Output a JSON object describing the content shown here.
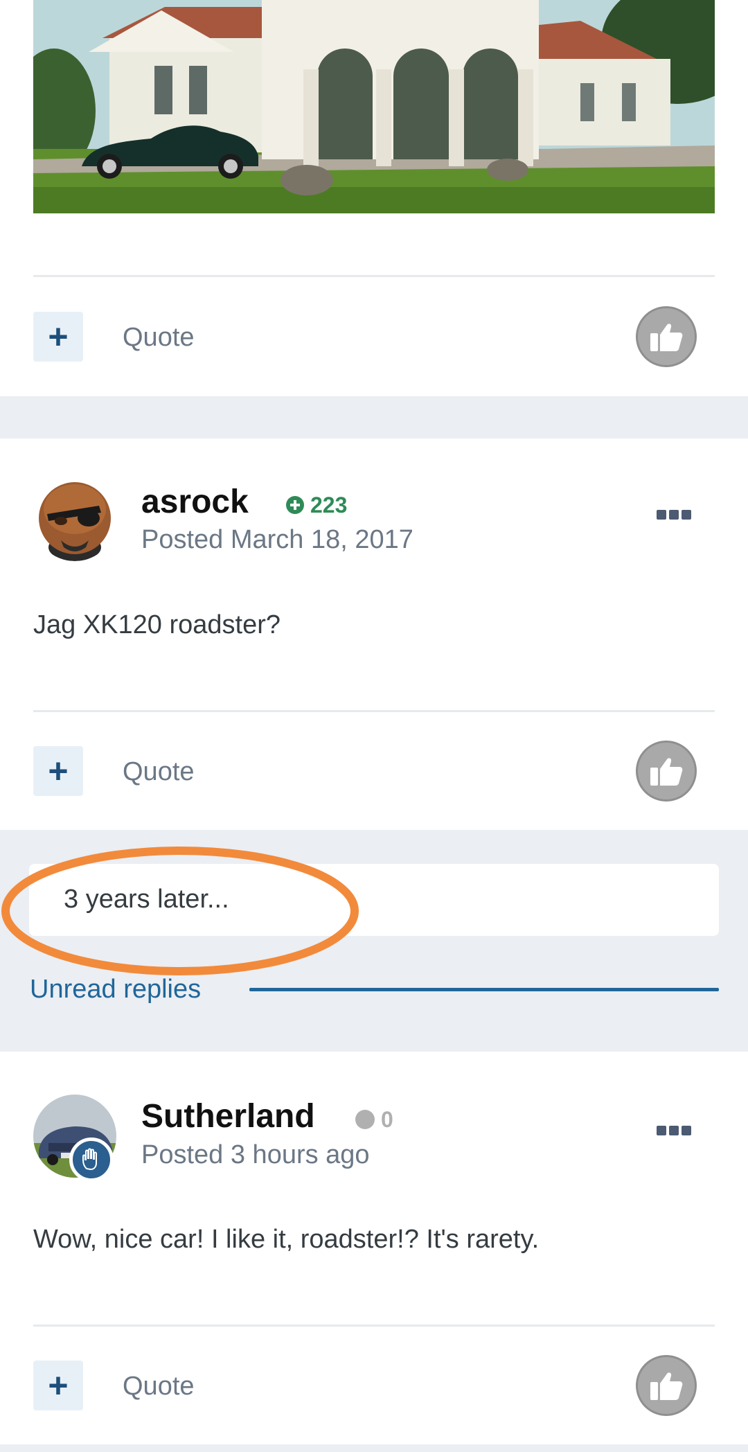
{
  "posts": [
    {
      "actions": {
        "quote_label": "Quote",
        "plus_symbol": "+"
      }
    },
    {
      "author": "asrock",
      "reputation": "223",
      "posted": "Posted March 18, 2017",
      "text": "Jag XK120 roadster?",
      "actions": {
        "quote_label": "Quote",
        "plus_symbol": "+"
      }
    },
    {
      "author": "Sutherland",
      "reputation": "0",
      "posted": "Posted 3 hours ago",
      "text": "Wow, nice car! I like it, roadster!? It's rarety.",
      "actions": {
        "quote_label": "Quote",
        "plus_symbol": "+"
      }
    }
  ],
  "time_gap": "3 years later...",
  "unread_label": "Unread replies",
  "colors": {
    "accent": "#1f6699",
    "reputation_positive": "#2e8b57",
    "reputation_neutral": "#b0b0b0",
    "highlight": "#f28a3b"
  },
  "icons": {
    "like": "thumbs-up-icon",
    "more": "ellipsis-icon",
    "plus": "plus-icon",
    "rep_positive": "plus-circle-icon",
    "rep_neutral": "dot-icon",
    "badge": "hand-icon"
  }
}
